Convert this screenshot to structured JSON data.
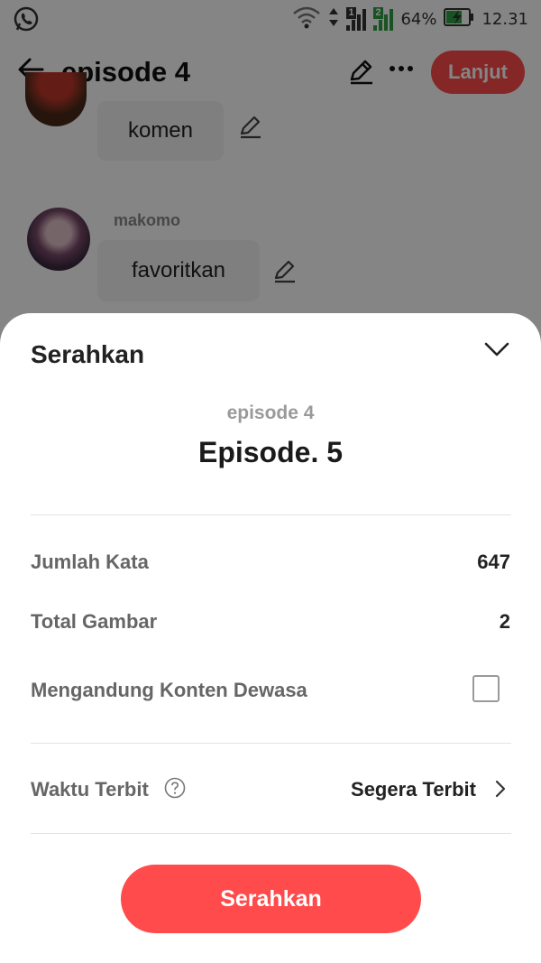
{
  "status_bar": {
    "battery_percent": "64%",
    "time": "12.31",
    "sim1_label": "1",
    "sim2_label": "2"
  },
  "header": {
    "title": "episode 4",
    "next_label": "Lanjut"
  },
  "comments": [
    {
      "username": "",
      "text": "komen"
    },
    {
      "username": "makomo",
      "text": "favoritkan"
    }
  ],
  "sheet": {
    "title": "Serahkan",
    "subtitle": "episode 4",
    "episode_title": "Episode. 5",
    "rows": [
      {
        "label": "Jumlah Kata",
        "value": "647"
      },
      {
        "label": "Total Gambar",
        "value": "2"
      },
      {
        "label": "Mengandung Konten Dewasa",
        "checked": false
      }
    ],
    "publish_time": {
      "label": "Waktu Terbit",
      "value": "Segera Terbit"
    },
    "submit_label": "Serahkan"
  },
  "colors": {
    "accent": "#ff4b4b",
    "overlay": "rgba(0,0,0,0.48)"
  }
}
